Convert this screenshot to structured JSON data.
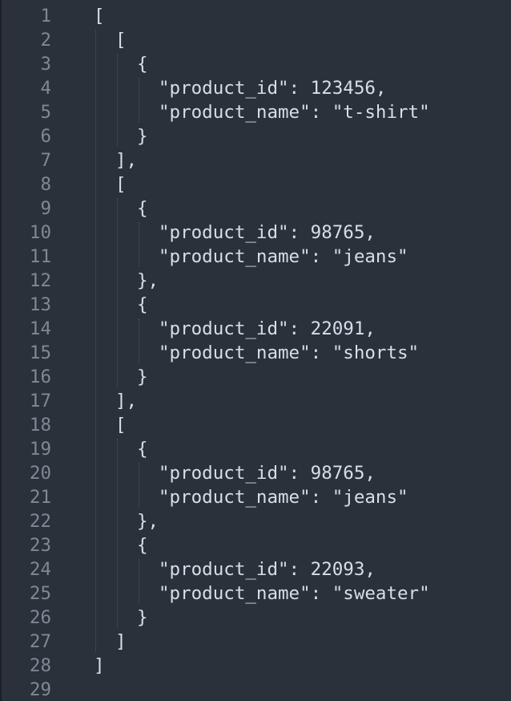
{
  "editor": {
    "lines": [
      {
        "number": "1",
        "indent": 0,
        "text": "["
      },
      {
        "number": "2",
        "indent": 1,
        "text": "["
      },
      {
        "number": "3",
        "indent": 2,
        "text": "{"
      },
      {
        "number": "4",
        "indent": 3,
        "text": "\"product_id\": 123456,"
      },
      {
        "number": "5",
        "indent": 3,
        "text": "\"product_name\": \"t-shirt\""
      },
      {
        "number": "6",
        "indent": 2,
        "text": "}"
      },
      {
        "number": "7",
        "indent": 1,
        "text": "],"
      },
      {
        "number": "8",
        "indent": 1,
        "text": "["
      },
      {
        "number": "9",
        "indent": 2,
        "text": "{"
      },
      {
        "number": "10",
        "indent": 3,
        "text": "\"product_id\": 98765,"
      },
      {
        "number": "11",
        "indent": 3,
        "text": "\"product_name\": \"jeans\""
      },
      {
        "number": "12",
        "indent": 2,
        "text": "},"
      },
      {
        "number": "13",
        "indent": 2,
        "text": "{"
      },
      {
        "number": "14",
        "indent": 3,
        "text": "\"product_id\": 22091,"
      },
      {
        "number": "15",
        "indent": 3,
        "text": "\"product_name\": \"shorts\""
      },
      {
        "number": "16",
        "indent": 2,
        "text": "}"
      },
      {
        "number": "17",
        "indent": 1,
        "text": "],"
      },
      {
        "number": "18",
        "indent": 1,
        "text": "["
      },
      {
        "number": "19",
        "indent": 2,
        "text": "{"
      },
      {
        "number": "20",
        "indent": 3,
        "text": "\"product_id\": 98765,"
      },
      {
        "number": "21",
        "indent": 3,
        "text": "\"product_name\": \"jeans\""
      },
      {
        "number": "22",
        "indent": 2,
        "text": "},"
      },
      {
        "number": "23",
        "indent": 2,
        "text": "{"
      },
      {
        "number": "24",
        "indent": 3,
        "text": "\"product_id\": 22093,"
      },
      {
        "number": "25",
        "indent": 3,
        "text": "\"product_name\": \"sweater\""
      },
      {
        "number": "26",
        "indent": 2,
        "text": "}"
      },
      {
        "number": "27",
        "indent": 1,
        "text": "]"
      },
      {
        "number": "28",
        "indent": 0,
        "text": "]"
      },
      {
        "number": "29",
        "indent": 0,
        "text": ""
      }
    ]
  }
}
